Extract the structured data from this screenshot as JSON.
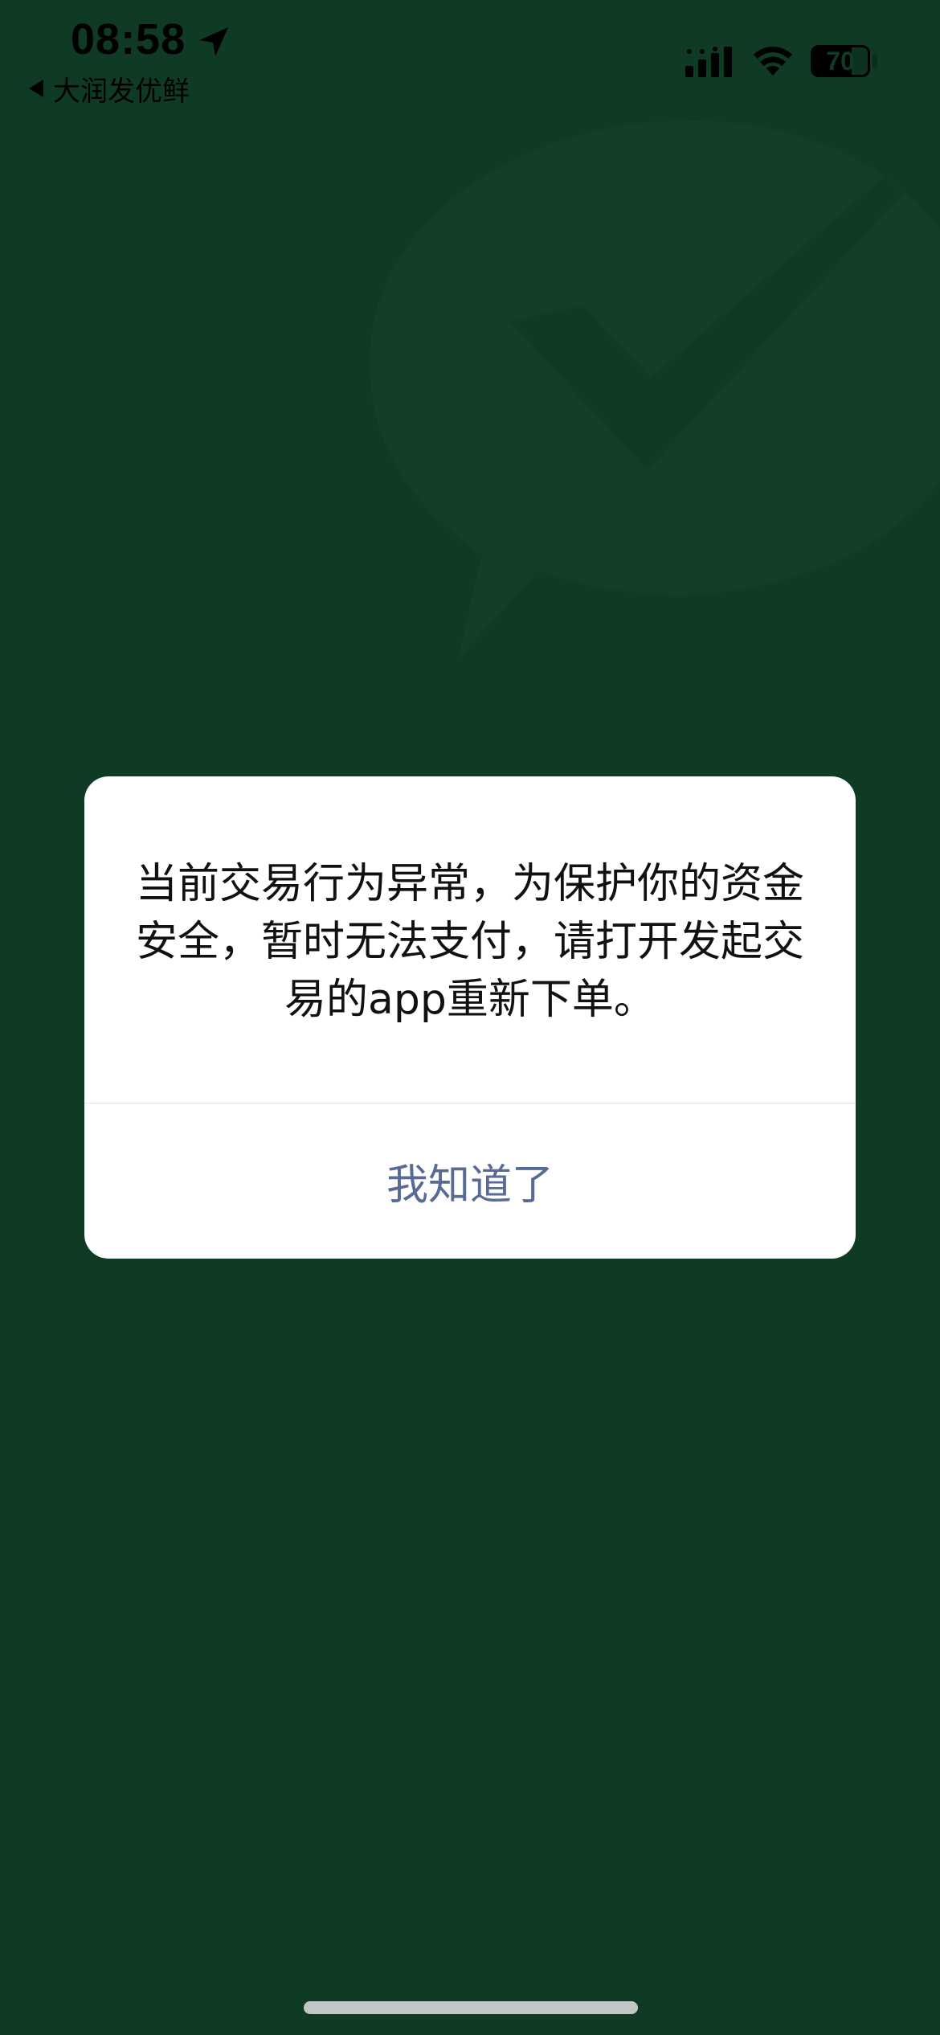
{
  "status_bar": {
    "time": "08:58",
    "back_app_label": "大润发优鲜",
    "battery_level_text": "70",
    "battery_percent": 70,
    "icons": [
      "location-arrow-icon",
      "back-triangle-icon",
      "cellular-signal-icon",
      "wifi-icon",
      "battery-icon"
    ]
  },
  "background": {
    "logo": "wechat-pay-logo-icon",
    "color": "#0f3b24"
  },
  "dialog": {
    "message": "当前交易行为异常，为保护你的资金安全，暂时无法支付，请打开发起交易的app重新下单。",
    "button_label": "我知道了",
    "button_color": "#576b95"
  }
}
